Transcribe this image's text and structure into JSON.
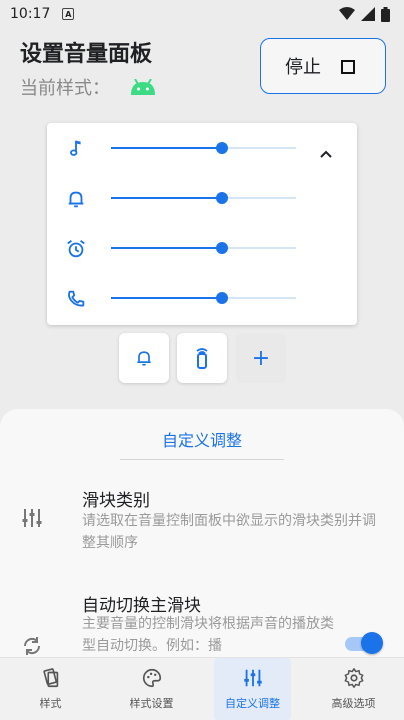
{
  "status_bar": {
    "time": "10:17",
    "notification_letter": "A"
  },
  "header": {
    "title": "设置音量面板",
    "style_label": "当前样式："
  },
  "stop_button": {
    "label": "停止"
  },
  "sliders": [
    {
      "name": "music",
      "level": 0.6
    },
    {
      "name": "notification",
      "level": 0.6
    },
    {
      "name": "alarm",
      "level": 0.6
    },
    {
      "name": "call",
      "level": 0.6
    }
  ],
  "quick_buttons": {
    "add_label": "+"
  },
  "sheet": {
    "title": "自定义调整",
    "settings": [
      {
        "title": "滑块类别",
        "desc": "请选取在音量控制面板中欲显示的滑块类别并调整其顺序"
      },
      {
        "title": "自动切换主滑块",
        "desc": "主要音量的控制滑块将根据声音的播放类型自动切换。例如：播"
      }
    ],
    "auto_switch_enabled": true
  },
  "bottom_nav": [
    {
      "label": "样式",
      "active": false
    },
    {
      "label": "样式设置",
      "active": false
    },
    {
      "label": "自定义调整",
      "active": true
    },
    {
      "label": "高级选项",
      "active": false
    }
  ],
  "colors": {
    "accent": "#1a73e8",
    "android_green": "#3ddc84"
  }
}
